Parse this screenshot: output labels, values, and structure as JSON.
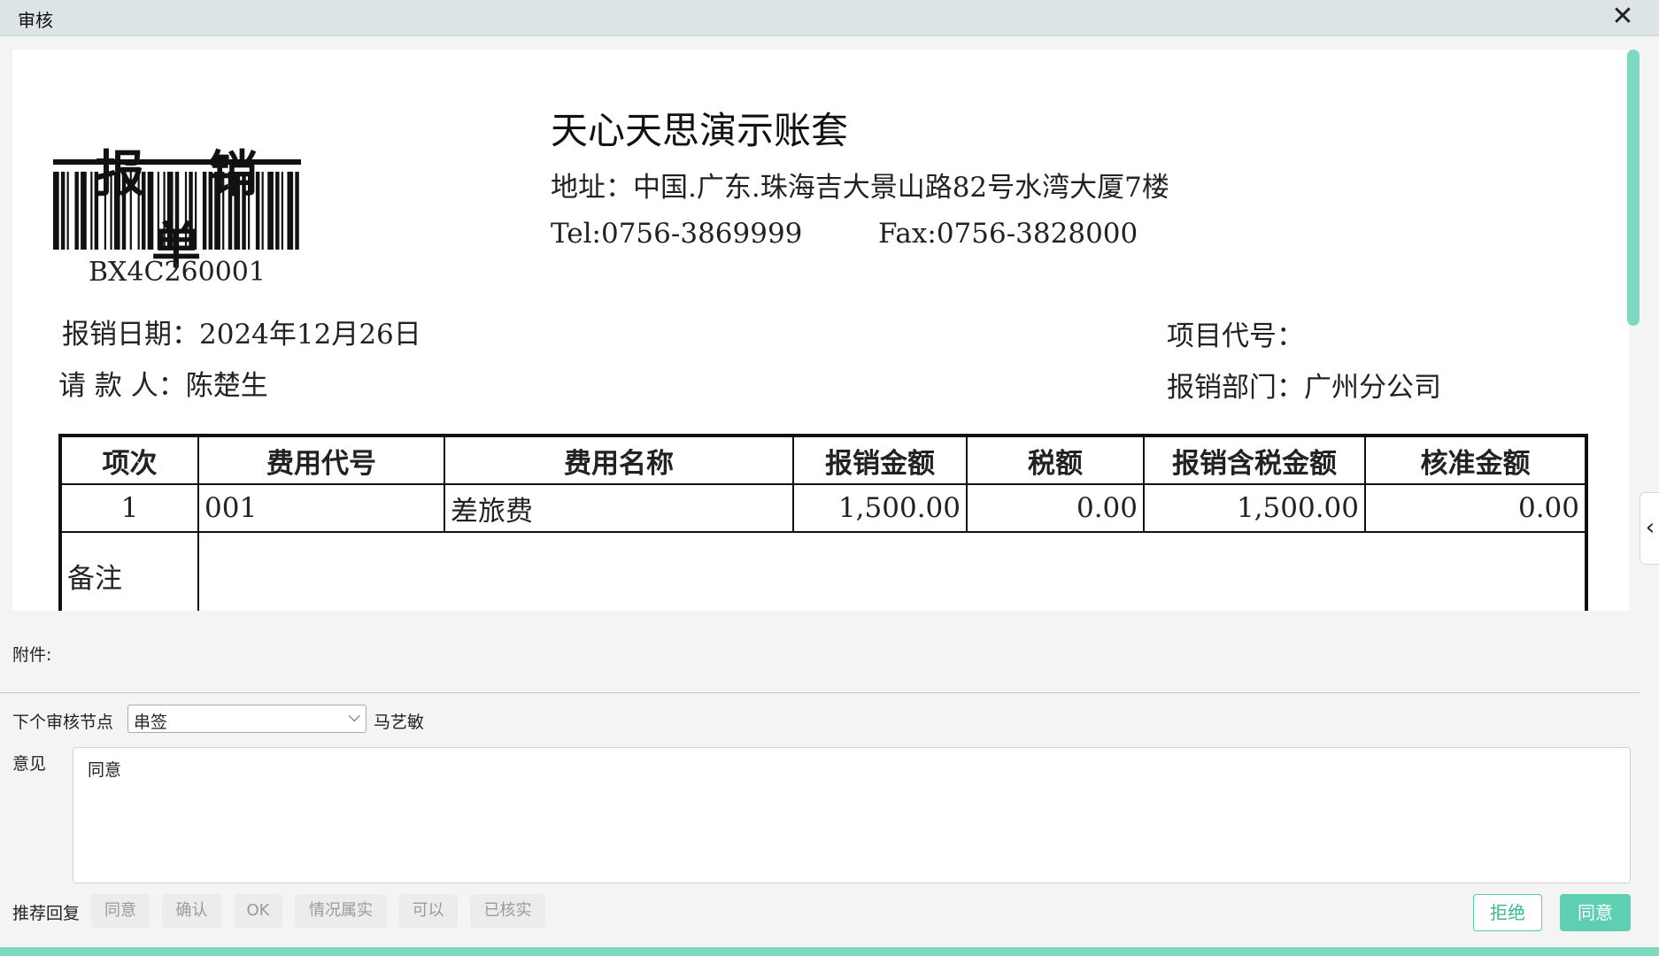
{
  "window": {
    "title": "审核"
  },
  "document": {
    "title": "报 销 单",
    "barcode_number": "BX4C260001",
    "company": {
      "name": "天心天思演示账套",
      "address": "地址：中国.广东.珠海吉大景山路82号水湾大厦7楼",
      "tel": "Tel:0756-3869999",
      "fax": "Fax:0756-3828000"
    },
    "info": {
      "date": "报销日期：2024年12月26日",
      "payee": "请 款 人：陈楚生",
      "project_code": "项目代号：",
      "department": "报销部门：广州分公司"
    },
    "table": {
      "headers": [
        "项次",
        "费用代号",
        "费用名称",
        "报销金额",
        "税额",
        "报销含税金额",
        "核准金额"
      ],
      "rows": [
        [
          "1",
          "001",
          "差旅费",
          "1,500.00",
          "0.00",
          "1,500.00",
          "0.00"
        ]
      ],
      "remark_label": "备注",
      "remark_value": ""
    }
  },
  "form": {
    "attachment_label": "附件:",
    "next_node_label": "下个审核节点",
    "next_node_value": "串签",
    "approver": "马艺敏",
    "opinion_label": "意见",
    "opinion_value": "同意",
    "suggest_label": "推荐回复",
    "suggestions": [
      "同意",
      "确认",
      "OK",
      "情况属实",
      "可以",
      "已核实"
    ],
    "reject_label": "拒绝",
    "agree_label": "同意"
  },
  "colors": {
    "accent": "#5fcfb2",
    "scrollbar": "#7fd8c0",
    "titlebar": "#dde4e7"
  }
}
